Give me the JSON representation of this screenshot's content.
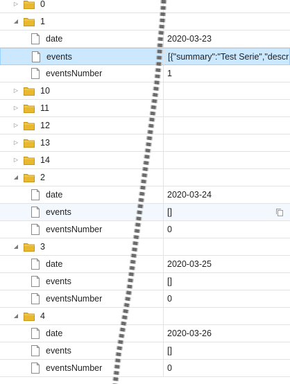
{
  "tree": {
    "rows": [
      {
        "kind": "folder",
        "expanded": false,
        "name": "0",
        "value": ""
      },
      {
        "kind": "folder",
        "expanded": true,
        "name": "1",
        "value": ""
      },
      {
        "kind": "leaf",
        "name": "date",
        "value": "2020-03-23"
      },
      {
        "kind": "leaf",
        "name": "events",
        "value": "[{\"summary\":\"Test Serie\",\"descr",
        "selected": true
      },
      {
        "kind": "leaf",
        "name": "eventsNumber",
        "value": "1"
      },
      {
        "kind": "folder",
        "expanded": false,
        "name": "10",
        "value": ""
      },
      {
        "kind": "folder",
        "expanded": false,
        "name": "11",
        "value": ""
      },
      {
        "kind": "folder",
        "expanded": false,
        "name": "12",
        "value": ""
      },
      {
        "kind": "folder",
        "expanded": false,
        "name": "13",
        "value": ""
      },
      {
        "kind": "folder",
        "expanded": false,
        "name": "14",
        "value": ""
      },
      {
        "kind": "folder",
        "expanded": true,
        "name": "2",
        "value": ""
      },
      {
        "kind": "leaf",
        "name": "date",
        "value": "2020-03-24"
      },
      {
        "kind": "leaf",
        "name": "events",
        "value": "[]",
        "hover": true,
        "copy": true
      },
      {
        "kind": "leaf",
        "name": "eventsNumber",
        "value": "0"
      },
      {
        "kind": "folder",
        "expanded": true,
        "name": "3",
        "value": ""
      },
      {
        "kind": "leaf",
        "name": "date",
        "value": "2020-03-25"
      },
      {
        "kind": "leaf",
        "name": "events",
        "value": "[]"
      },
      {
        "kind": "leaf",
        "name": "eventsNumber",
        "value": "0"
      },
      {
        "kind": "folder",
        "expanded": true,
        "name": "4",
        "value": ""
      },
      {
        "kind": "leaf",
        "name": "date",
        "value": "2020-03-26"
      },
      {
        "kind": "leaf",
        "name": "events",
        "value": "[]"
      },
      {
        "kind": "leaf",
        "name": "eventsNumber",
        "value": "0"
      }
    ]
  },
  "colors": {
    "selected_bg": "#cce8ff",
    "selected_border": "#99d1ff",
    "folder_yellow": "#e8b92e",
    "grid": "#e3e3e3"
  },
  "icons": {
    "collapsed": "chevron-right-icon",
    "expanded": "chevron-down-icon",
    "folder": "folder-icon",
    "leaf": "file-icon",
    "copy": "copy-icon"
  }
}
